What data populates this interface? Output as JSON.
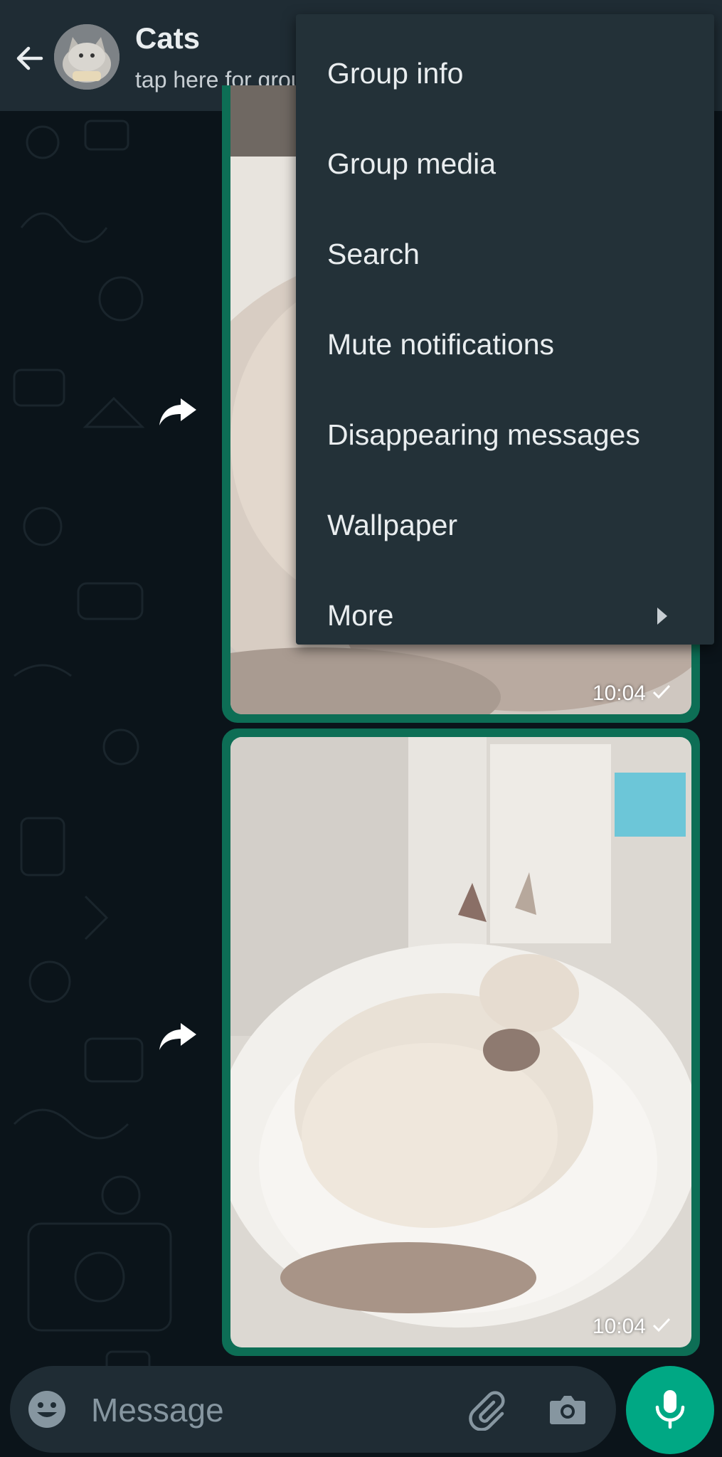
{
  "header": {
    "title": "Cats",
    "subtitle": "tap here for group info"
  },
  "messages": [
    {
      "time": "10:04",
      "status": "sent-check-icon"
    },
    {
      "time": "10:04",
      "status": "sent-check-icon"
    }
  ],
  "menu": {
    "items": [
      {
        "label": "Group info"
      },
      {
        "label": "Group media"
      },
      {
        "label": "Search"
      },
      {
        "label": "Mute notifications"
      },
      {
        "label": "Disappearing messages"
      },
      {
        "label": "Wallpaper"
      },
      {
        "label": "More",
        "has_submenu": true
      }
    ]
  },
  "composer": {
    "placeholder": "Message"
  },
  "colors": {
    "header_bg": "#1f2c34",
    "chat_bg": "#0b141a",
    "menu_bg": "#233138",
    "accent": "#00a884",
    "bubble_border": "#0d6e55"
  },
  "icons": [
    "back-arrow-icon",
    "forward-icon",
    "emoji-icon",
    "attach-icon",
    "camera-icon",
    "mic-icon",
    "chevron-right-icon",
    "check-icon"
  ]
}
